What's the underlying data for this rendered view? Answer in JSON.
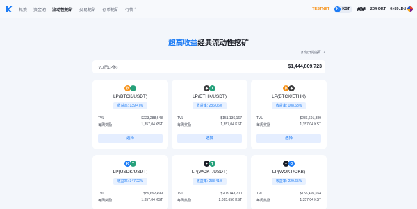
{
  "nav": {
    "items": [
      {
        "label": "兑换",
        "active": false,
        "caret": ""
      },
      {
        "label": "资金池",
        "active": false,
        "caret": ""
      },
      {
        "label": "流动性挖矿",
        "active": true,
        "caret": ""
      },
      {
        "label": "交易挖矿",
        "active": false,
        "caret": ""
      },
      {
        "label": "存币挖矿",
        "active": false,
        "caret": ""
      },
      {
        "label": "行情",
        "active": false,
        "caret": "↗"
      }
    ],
    "testnet": "TESTNET",
    "token_symbol": "KST",
    "token_icon": "K",
    "swap_icon": "ᚏ",
    "balance": "204 OKT",
    "wallet": "0×89..Dd",
    "colors": {
      "accent": "#1b7bf5",
      "testnet": "#f7931a"
    }
  },
  "headline": {
    "highlight": "超高收益",
    "rest": "经典流动性挖矿"
  },
  "howto_link": "如何开始挖矿 ↗",
  "tvl": {
    "label": "TVL(已LP池)",
    "value": "$1,444,809,723"
  },
  "pools": [
    {
      "tokens": [
        {
          "t": "₿",
          "c": "#f7931a"
        },
        {
          "t": "T",
          "c": "#26a17b"
        }
      ],
      "name": "LP(BTCK/USDT)",
      "apy": "收益率: 139.47%",
      "tvl_label": "TVL",
      "tvl": "$223,288,648",
      "reward_label": "每周奖励",
      "reward": "1,357,04 KST",
      "button": "选择"
    },
    {
      "tokens": [
        {
          "t": "◆",
          "c": "#3c3c3d"
        },
        {
          "t": "T",
          "c": "#26a17b"
        }
      ],
      "name": "LP(ETHK/USDT)",
      "apy": "收益率: 286.06%",
      "tvl_label": "TVL",
      "tvl": "$151,136,167",
      "reward_label": "每周奖励",
      "reward": "1,357,04 KST",
      "button": "选择"
    },
    {
      "tokens": [
        {
          "t": "₿",
          "c": "#f7931a"
        },
        {
          "t": "◆",
          "c": "#3c3c3d"
        }
      ],
      "name": "LP(BTCK/ETHK)",
      "apy": "收益率: 108.63%",
      "tvl_label": "TVL",
      "tvl": "$286,691,389",
      "reward_label": "每周奖励",
      "reward": "1,357,04 KST",
      "button": "选择"
    },
    {
      "tokens": [
        {
          "t": "K",
          "c": "#1b7bf5"
        },
        {
          "t": "T",
          "c": "#26a17b"
        }
      ],
      "name": "LP(USDK/USDT)",
      "apy": "收益率: 347.22%",
      "tvl_label": "TVL",
      "tvl": "$89,692,499",
      "reward_label": "每周奖励",
      "reward": "1,357,04 KST",
      "button": "选择"
    },
    {
      "tokens": [
        {
          "t": "✦",
          "c": "#1a1d26"
        },
        {
          "t": "T",
          "c": "#26a17b"
        }
      ],
      "name": "LP(WOKT/USDT)",
      "apy": "收益率: 233.41%",
      "tvl_label": "TVL",
      "tvl": "$208,143,700",
      "reward_label": "每周奖励",
      "reward": "2,035,656 KST",
      "button": "选择"
    },
    {
      "tokens": [
        {
          "t": "✦",
          "c": "#1a1d26"
        },
        {
          "t": "O",
          "c": "#1b7bf5"
        }
      ],
      "name": "LP(WOKT/OKB)",
      "apy": "收益率: 229.65%",
      "tvl_label": "TVL",
      "tvl": "$155,495,654",
      "reward_label": "每周奖励",
      "reward": "1,357,04 KST",
      "button": "选择"
    }
  ]
}
